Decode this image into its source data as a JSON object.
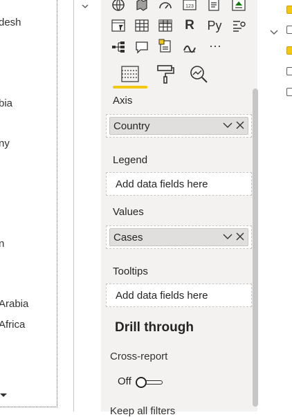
{
  "left_list": {
    "items": [
      {
        "label": "desh"
      },
      {
        "label": "bia"
      },
      {
        "label": "ny"
      },
      {
        "label": "n"
      },
      {
        "label": "Arabia"
      },
      {
        "label": "Africa"
      }
    ]
  },
  "viz_icons": [
    "globe-map-icon",
    "filled-map-icon",
    "gauge-icon",
    "card-icon",
    "multi-row-card-icon",
    "kpi-icon",
    "slicer-icon",
    "table-icon",
    "matrix-icon",
    "r-visual-icon",
    "python-visual-icon",
    "key-influencers-icon",
    "decomposition-tree-icon",
    "qa-icon",
    "smart-narrative-icon",
    "arcgis-map-icon",
    "more-visuals-icon"
  ],
  "viz_text_icons": {
    "r": "R",
    "py": "Py",
    "card": "123",
    "more": "···"
  },
  "tabs": [
    "fields-tab",
    "format-tab",
    "analytics-tab"
  ],
  "wells": {
    "axis": {
      "label": "Axis",
      "field": "Country"
    },
    "legend": {
      "label": "Legend",
      "placeholder": "Add data fields here"
    },
    "values": {
      "label": "Values",
      "field": "Cases"
    },
    "tooltips": {
      "label": "Tooltips",
      "placeholder": "Add data fields here"
    }
  },
  "drill_through": {
    "heading": "Drill through",
    "cross_report": "Cross-report",
    "toggle_state": "Off",
    "keep_all_filters": "Keep all filters"
  },
  "colors": {
    "accent": "#f2c811",
    "pane_bg": "#f3f2f1",
    "pill_bg": "#e1dfdd"
  }
}
